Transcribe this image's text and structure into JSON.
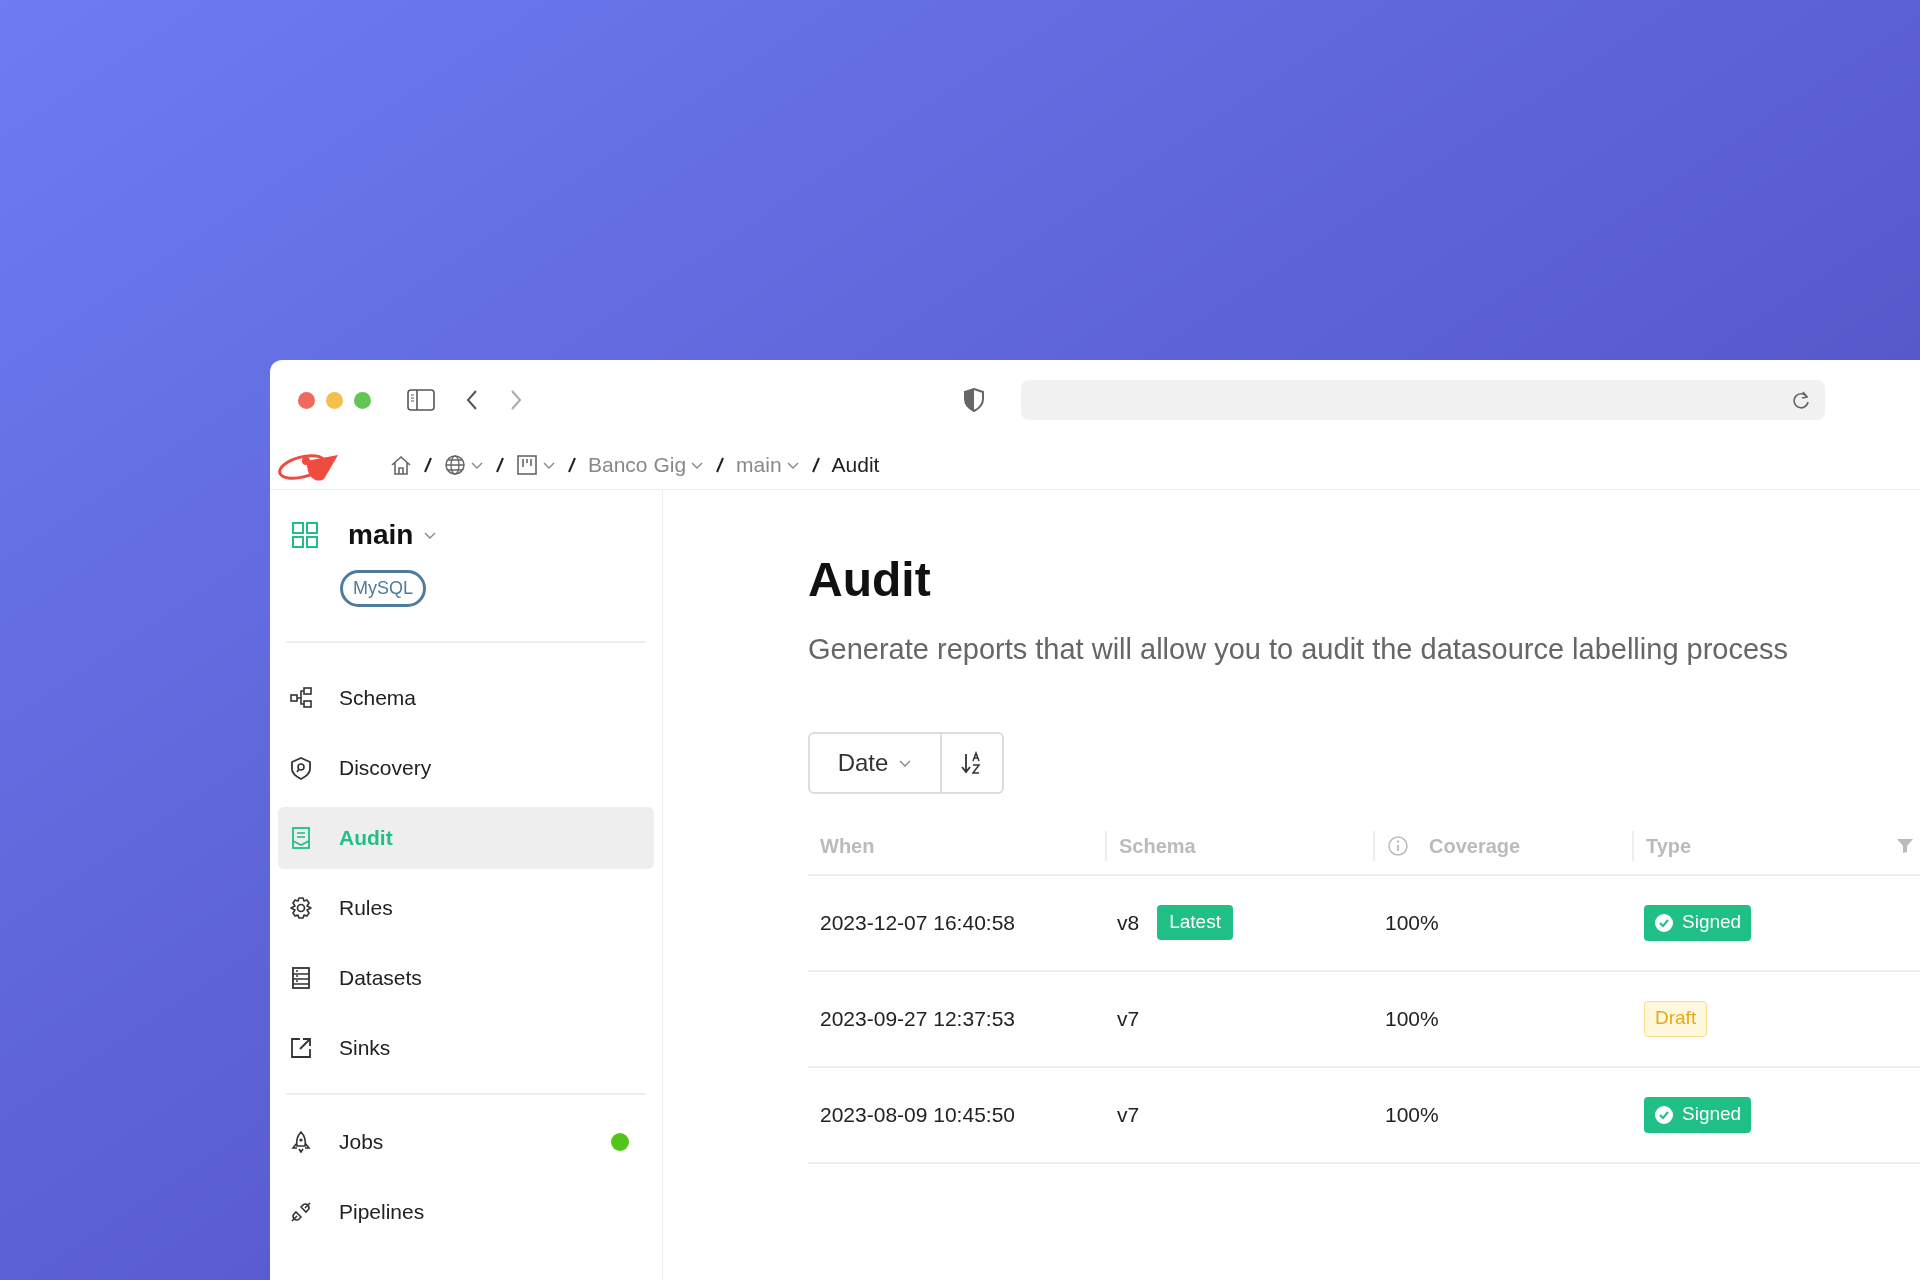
{
  "breadcrumb": {
    "items": [
      {
        "kind": "home"
      },
      {
        "kind": "globe",
        "dropdown": true
      },
      {
        "kind": "board",
        "dropdown": true
      },
      {
        "kind": "text",
        "label": "Banco Gig",
        "dropdown": true
      },
      {
        "kind": "text",
        "label": "main",
        "dropdown": true
      },
      {
        "kind": "current",
        "label": "Audit"
      }
    ]
  },
  "sidebar": {
    "workspace": "main",
    "engine": "MySQL",
    "groups": [
      [
        {
          "label": "Schema",
          "selected": false,
          "running": false
        },
        {
          "label": "Discovery",
          "selected": false,
          "running": false
        },
        {
          "label": "Audit",
          "selected": true,
          "running": false
        },
        {
          "label": "Rules",
          "selected": false,
          "running": false
        },
        {
          "label": "Datasets",
          "selected": false,
          "running": false
        },
        {
          "label": "Sinks",
          "selected": false,
          "running": false
        }
      ],
      [
        {
          "label": "Jobs",
          "selected": false,
          "running": true
        },
        {
          "label": "Pipelines",
          "selected": false,
          "running": false
        }
      ]
    ]
  },
  "page": {
    "title": "Audit",
    "subtitle": "Generate reports that will allow you to audit the datasource labelling process",
    "sort": {
      "field": "Date"
    }
  },
  "table": {
    "columns": [
      {
        "label": "When"
      },
      {
        "label": "Schema"
      },
      {
        "label": "Coverage",
        "info": true
      },
      {
        "label": "Type",
        "filter": true
      }
    ],
    "rows": [
      {
        "when": "2023-12-07 16:40:58",
        "schema": "v8",
        "badge": "Latest",
        "coverage": "100%",
        "type": {
          "label": "Signed",
          "kind": "signed"
        }
      },
      {
        "when": "2023-09-27 12:37:53",
        "schema": "v7",
        "coverage": "100%",
        "type": {
          "label": "Draft",
          "kind": "draft"
        }
      },
      {
        "when": "2023-08-09 10:45:50",
        "schema": "v7",
        "coverage": "100%",
        "type": {
          "label": "Signed",
          "kind": "signed"
        }
      }
    ]
  }
}
